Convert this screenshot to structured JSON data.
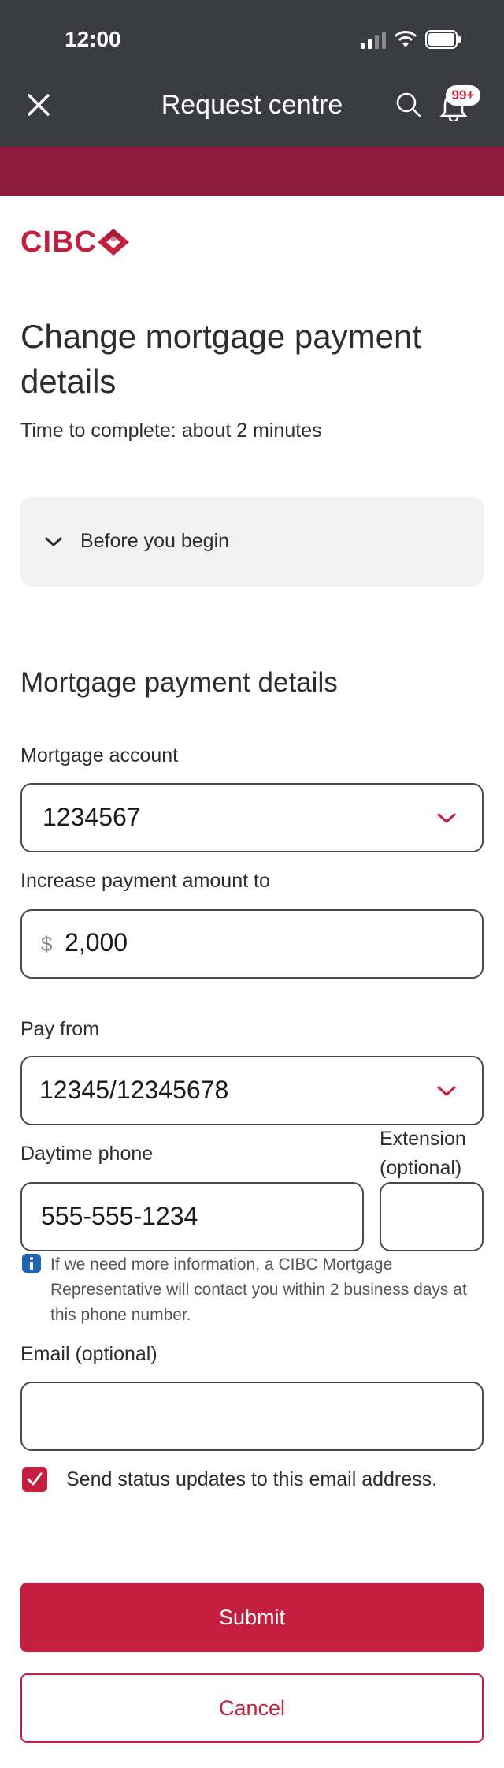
{
  "status_bar": {
    "time": "12:00"
  },
  "header": {
    "title": "Request centre",
    "notification_count": "99+"
  },
  "brand": {
    "logo_text": "CIBC",
    "accent": "#c41f3e",
    "band_color": "#8c1b3c",
    "header_color": "#3a3c3f"
  },
  "page": {
    "title": "Change mortgage payment details",
    "time_note": "Time to complete: about 2 minutes"
  },
  "accordion": {
    "label": "Before you begin",
    "icon": "chevron-down-icon"
  },
  "form": {
    "section_title": "Mortgage payment details",
    "mortgage_account": {
      "label": "Mortgage account",
      "value": "1234567"
    },
    "increase_payment": {
      "label": "Increase payment amount to",
      "currency": "$",
      "value": "2,000"
    },
    "pay_from": {
      "label": "Pay from",
      "value": "12345/12345678"
    },
    "daytime_phone": {
      "label": "Daytime phone",
      "value": "555-555-1234"
    },
    "extension": {
      "label_line1": "Extension",
      "label_line2": "(optional)",
      "value": ""
    },
    "info_text": "If we need more information, a CIBC Mortgage Representative will contact you within 2 business days at this phone number.",
    "email": {
      "label": "Email (optional)",
      "value": ""
    },
    "status_updates": {
      "label": "Send status updates to this email address.",
      "checked": true
    }
  },
  "actions": {
    "submit_label": "Submit",
    "cancel_label": "Cancel"
  }
}
